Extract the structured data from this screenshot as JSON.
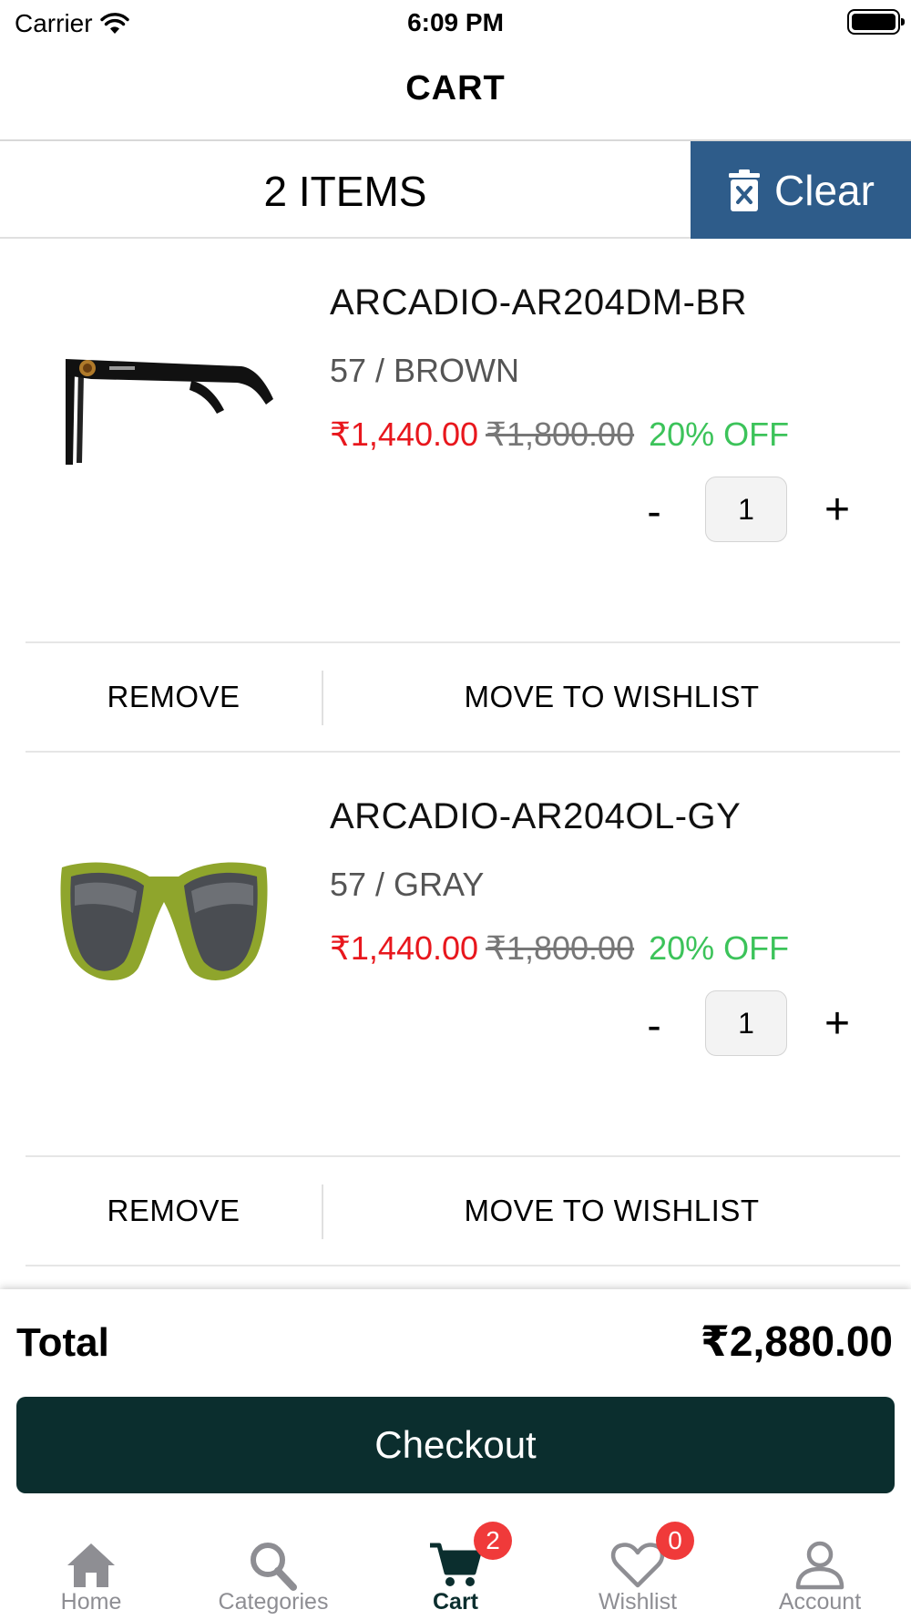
{
  "status_bar": {
    "carrier": "Carrier",
    "time": "6:09 PM"
  },
  "nav": {
    "title": "CART"
  },
  "cart_header": {
    "items_count": "2 ITEMS",
    "clear_label": "Clear"
  },
  "items": [
    {
      "name": "ARCADIO-AR204DM-BR",
      "variant": "57 / BROWN",
      "price": "₹1,440.00",
      "original_price": "₹1,800.00",
      "discount": "20% OFF",
      "quantity": "1",
      "minus_label": "-",
      "plus_label": "+",
      "remove_label": "REMOVE",
      "wishlist_label": "MOVE TO WISHLIST"
    },
    {
      "name": "ARCADIO-AR204OL-GY",
      "variant": "57 / GRAY",
      "price": "₹1,440.00",
      "original_price": "₹1,800.00",
      "discount": "20% OFF",
      "quantity": "1",
      "minus_label": "-",
      "plus_label": "+",
      "remove_label": "REMOVE",
      "wishlist_label": "MOVE TO WISHLIST"
    }
  ],
  "summary": {
    "total_label": "Total",
    "total_value": "₹2,880.00",
    "checkout_label": "Checkout"
  },
  "tabs": [
    {
      "label": "Home",
      "icon": "home-icon"
    },
    {
      "label": "Categories",
      "icon": "search-icon"
    },
    {
      "label": "Cart",
      "icon": "cart-icon",
      "badge": "2",
      "active": true
    },
    {
      "label": "Wishlist",
      "icon": "heart-icon",
      "badge": "0"
    },
    {
      "label": "Account",
      "icon": "person-icon"
    }
  ],
  "colors": {
    "clear_button": "#2e5c8a",
    "checkout_button": "#0b2e2e",
    "price_now": "#e8171d",
    "discount": "#3cc35a",
    "badge": "#f03a3a",
    "tab_inactive": "#8e8e93"
  }
}
